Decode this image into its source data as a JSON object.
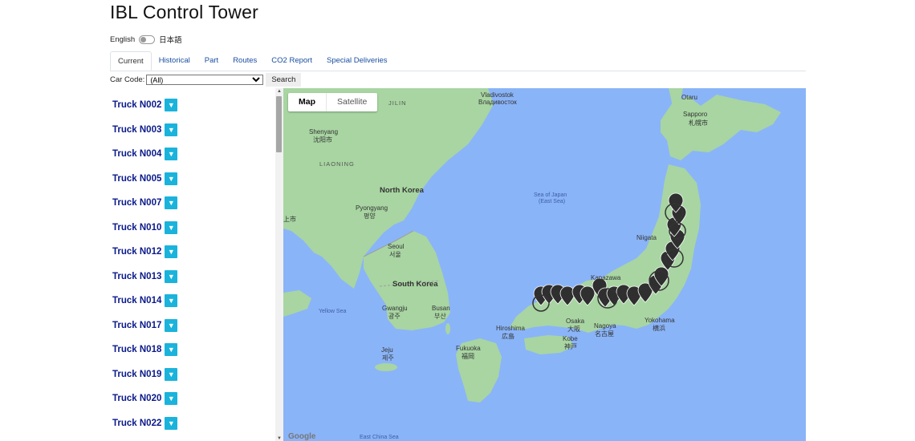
{
  "app": {
    "title": "IBL Control Tower"
  },
  "language": {
    "left": "English",
    "right": "日本語",
    "toggle_on": false
  },
  "tabs": [
    {
      "label": "Current",
      "active": true
    },
    {
      "label": "Historical",
      "active": false
    },
    {
      "label": "Part",
      "active": false
    },
    {
      "label": "Routes",
      "active": false
    },
    {
      "label": "CO2 Report",
      "active": false
    },
    {
      "label": "Special Deliveries",
      "active": false
    }
  ],
  "filter": {
    "label": "Car Code:",
    "selected": "(All)",
    "search_label": "Search"
  },
  "trucks": [
    {
      "label": "Truck N002"
    },
    {
      "label": "Truck N003"
    },
    {
      "label": "Truck N004"
    },
    {
      "label": "Truck N005"
    },
    {
      "label": "Truck N007"
    },
    {
      "label": "Truck N010"
    },
    {
      "label": "Truck N012"
    },
    {
      "label": "Truck N013"
    },
    {
      "label": "Truck N014"
    },
    {
      "label": "Truck N017"
    },
    {
      "label": "Truck N018"
    },
    {
      "label": "Truck N019"
    },
    {
      "label": "Truck N020"
    },
    {
      "label": "Truck N022"
    }
  ],
  "map": {
    "type_buttons": {
      "map": "Map",
      "satellite": "Satellite",
      "selected": "Map"
    },
    "labels": {
      "jilin": "JILIN",
      "vladivostok": "Vladivostok",
      "vladivostok_ru": "Владивосток",
      "shenyang": "Shenyang",
      "shenyang_zh": "沈阳市",
      "liaoning": "LIAONING",
      "north_korea": "North Korea",
      "pyongyang": "Pyongyang",
      "pyongyang_ko": "평양",
      "seoul": "Seoul",
      "seoul_ko": "서울",
      "south_korea": "South Korea",
      "gwangju": "Gwangju",
      "gwangju_ko": "광주",
      "busan": "Busan",
      "busan_ko": "부산",
      "jeju": "Jeju",
      "jeju_ko": "제주",
      "yellow_sea": "Yellow Sea",
      "sea_of_japan": "Sea of Japan",
      "east_sea": "(East Sea)",
      "sapporo": "Sapporo",
      "sapporo_ja": "札幌市",
      "otaru": "Otaru",
      "niigata": "Niigata",
      "hiroshima": "Hiroshima",
      "hiroshima_ja": "広島",
      "fukuoka": "Fukuoka",
      "fukuoka_ja": "福岡",
      "osaka": "Osaka",
      "osaka_ja": "大阪",
      "nagoya": "Nagoya",
      "nagoya_ja": "名古屋",
      "kobe": "Kobe",
      "kobe_ja": "神戸",
      "yokohama": "Yokohama",
      "yokohama_ja": "横浜",
      "kanazawa": "Kanazawa",
      "east_china_sea": "East China Sea",
      "tianjin_zh": "上市",
      "google": "Google"
    }
  },
  "colors": {
    "water": "#8ab4f8",
    "land": "#a8d5a2",
    "truck_link": "#0a1a8a",
    "expand_button": "#1ab3dc",
    "marker": "#333333"
  }
}
